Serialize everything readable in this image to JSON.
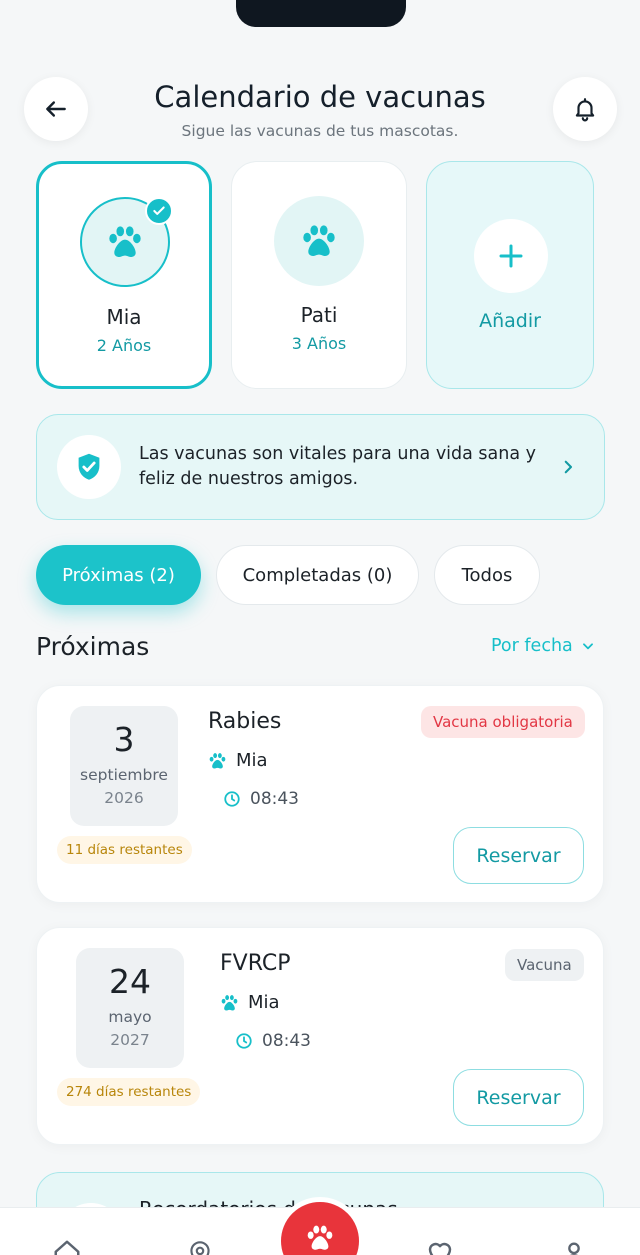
{
  "header": {
    "title": "Calendario de vacunas",
    "subtitle": "Sigue las vacunas de tus mascotas."
  },
  "pets": [
    {
      "name": "Mia",
      "age": "2 Años",
      "selected": true
    },
    {
      "name": "Pati",
      "age": "3 Años",
      "selected": false
    }
  ],
  "add_pet": {
    "label": "Añadir"
  },
  "info_banner": {
    "text": "Las vacunas son vitales para una vida sana y feliz de nuestros amigos."
  },
  "tabs": [
    {
      "label": "Próximas (2)",
      "active": true
    },
    {
      "label": "Completadas (0)",
      "active": false
    },
    {
      "label": "Todos",
      "active": false
    }
  ],
  "section": {
    "title": "Próximas",
    "sort_label": "Por fecha"
  },
  "vaccines": [
    {
      "day": "3",
      "month": "septiembre",
      "year": "2026",
      "days_left": "11 días restantes",
      "name": "Rabies",
      "pet": "Mia",
      "time": "08:43",
      "tag": "Vacuna obligatoria",
      "tag_type": "required",
      "action": "Reservar"
    },
    {
      "day": "24",
      "month": "mayo",
      "year": "2027",
      "days_left": "274 días restantes",
      "name": "FVRCP",
      "pet": "Mia",
      "time": "08:43",
      "tag": "Vacuna",
      "tag_type": "plain",
      "action": "Reservar"
    }
  ],
  "reminder": {
    "title": "Recordatorios de vacunas"
  },
  "colors": {
    "accent": "#1cc3ca",
    "fab": "#e8343b",
    "required": "#e23744"
  },
  "icons": {
    "back": "arrow-left-icon",
    "bell": "bell-icon",
    "paw": "paw-icon",
    "check": "check-icon",
    "plus": "plus-icon",
    "shield": "shield-check-icon",
    "chevron": "chevron-right-icon",
    "sort": "chevron-down-icon",
    "clock": "clock-icon",
    "nav": [
      "home-icon",
      "location-icon",
      "paw-icon",
      "heart-icon",
      "profile-icon"
    ]
  }
}
